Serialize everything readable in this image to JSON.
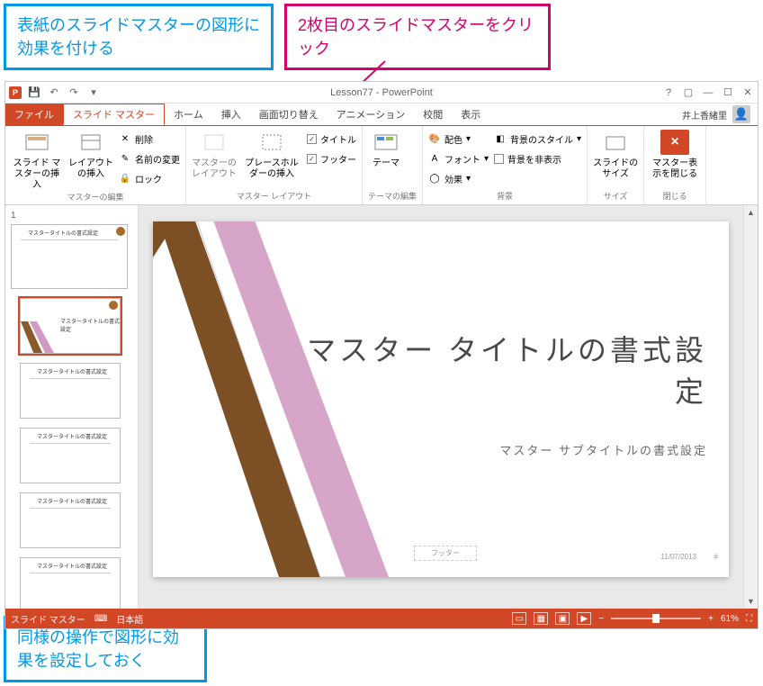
{
  "callouts": {
    "top_left": "表紙のスライドマスターの図形に効果を付ける",
    "top_right": "2枚目のスライドマスターをクリック",
    "bottom": "同様の操作で図形に効果を設定しておく"
  },
  "titlebar": {
    "title": "Lesson77 - PowerPoint"
  },
  "tabs": {
    "file": "ファイル",
    "slide_master": "スライド マスター",
    "home": "ホーム",
    "insert": "挿入",
    "transitions": "画面切り替え",
    "animations": "アニメーション",
    "review": "校閲",
    "view": "表示",
    "user": "井上香緒里"
  },
  "ribbon": {
    "group1": {
      "btn_insert_master": "スライド マスターの挿入",
      "btn_insert_layout": "レイアウトの挿入",
      "btn_delete": "削除",
      "btn_rename": "名前の変更",
      "btn_lock": "ロック",
      "label": "マスターの編集"
    },
    "group2": {
      "btn_master_layout": "マスターのレイアウト",
      "btn_placeholder": "プレースホルダーの挿入",
      "chk_title": "タイトル",
      "chk_footer": "フッター",
      "label": "マスター レイアウト"
    },
    "group3": {
      "btn_themes": "テーマ",
      "btn_colors": "配色",
      "btn_fonts": "フォント",
      "btn_effects": "効果",
      "btn_bg_style": "背景のスタイル",
      "chk_hide_bg": "背景を非表示",
      "label_theme": "テーマの編集",
      "label_bg": "背景"
    },
    "group4": {
      "btn_size": "スライドのサイズ",
      "label": "サイズ"
    },
    "group5": {
      "btn_close": "マスター表示を閉じる",
      "label": "閉じる"
    }
  },
  "thumbs": {
    "master_title": "マスタータイトルの書式設定",
    "layout_title": "マスタータイトルの書式設定"
  },
  "slide": {
    "title": "マスター タイトルの書式設定",
    "subtitle": "マスター サブタイトルの書式設定",
    "footer": "フッター",
    "date": "11/07/2013",
    "pagenum": "#"
  },
  "status": {
    "mode": "スライド マスター",
    "lang": "日本語",
    "zoom": "61%"
  }
}
